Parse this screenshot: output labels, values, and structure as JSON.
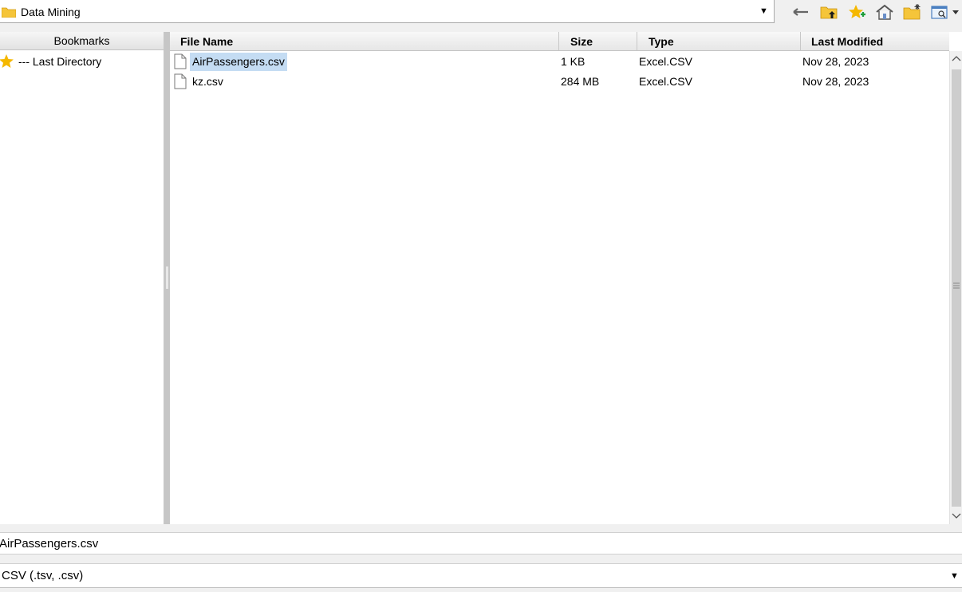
{
  "path_bar": {
    "current_folder": "Data Mining"
  },
  "toolbar": {
    "icons": [
      "back-arrow-icon",
      "parent-folder-icon",
      "add-bookmark-icon",
      "home-icon",
      "new-folder-icon",
      "view-options-icon"
    ]
  },
  "bookmarks": {
    "header": "Bookmarks",
    "items": [
      {
        "label": "--- Last Directory",
        "icon": "star-icon"
      }
    ]
  },
  "table": {
    "columns": [
      "File Name",
      "Size",
      "Type",
      "Last Modified"
    ],
    "rows": [
      {
        "name": "AirPassengers.csv",
        "size": "1 KB",
        "type": "Excel.CSV",
        "modified": "Nov 28, 2023",
        "selected": true
      },
      {
        "name": "kz.csv",
        "size": "284 MB",
        "type": "Excel.CSV",
        "modified": "Nov 28, 2023",
        "selected": false
      }
    ]
  },
  "filename_field": {
    "value": "AirPassengers.csv"
  },
  "filetype_select": {
    "selected": "CSV (.tsv, .csv)"
  },
  "colors": {
    "selection": "#c4dcf3",
    "folder": "#f5c53a",
    "star": "#f5b800"
  }
}
